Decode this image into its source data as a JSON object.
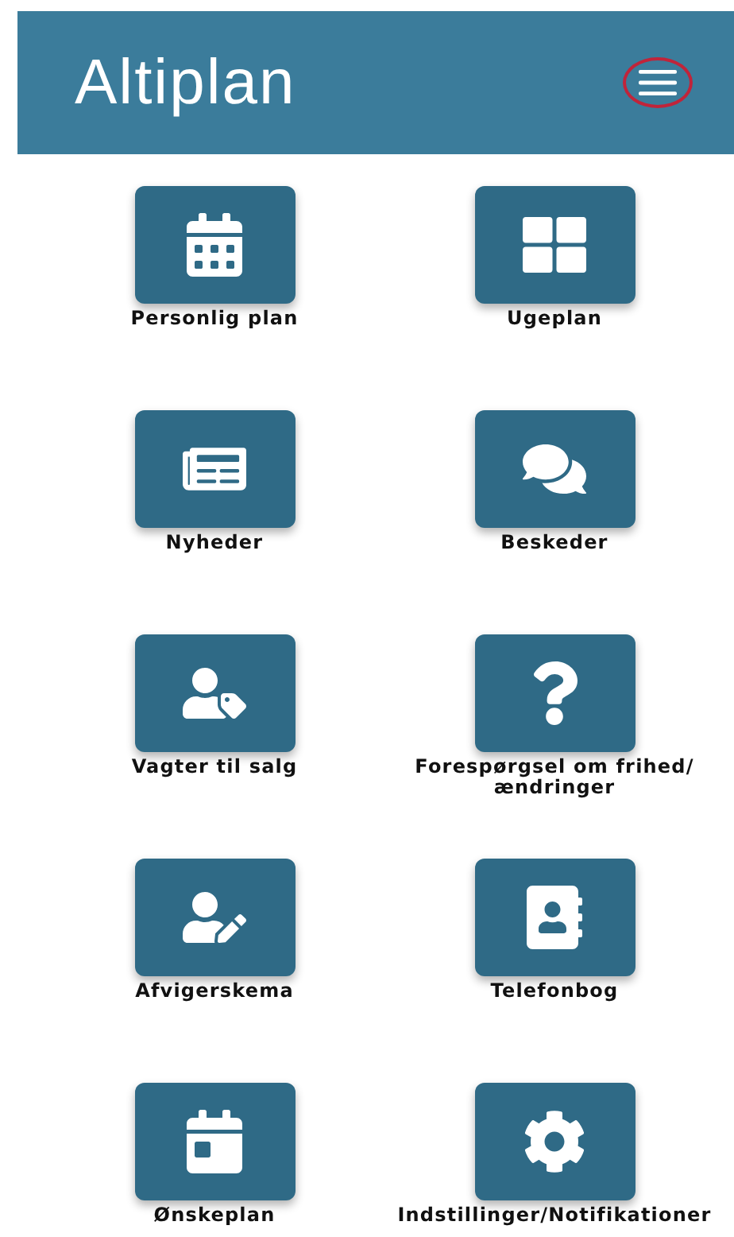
{
  "header": {
    "title": "Altiplan",
    "menu_highlighted": true
  },
  "tiles": [
    {
      "label": "Personlig plan"
    },
    {
      "label": "Ugeplan"
    },
    {
      "label": "Nyheder"
    },
    {
      "label": "Beskeder"
    },
    {
      "label": "Vagter til salg"
    },
    {
      "label": "Forespørgsel om frihed/ ændringer"
    },
    {
      "label": "Afvigerskema"
    },
    {
      "label": "Telefonbog"
    },
    {
      "label": "Ønskeplan"
    },
    {
      "label": "Indstillinger/Notifikationer"
    }
  ]
}
